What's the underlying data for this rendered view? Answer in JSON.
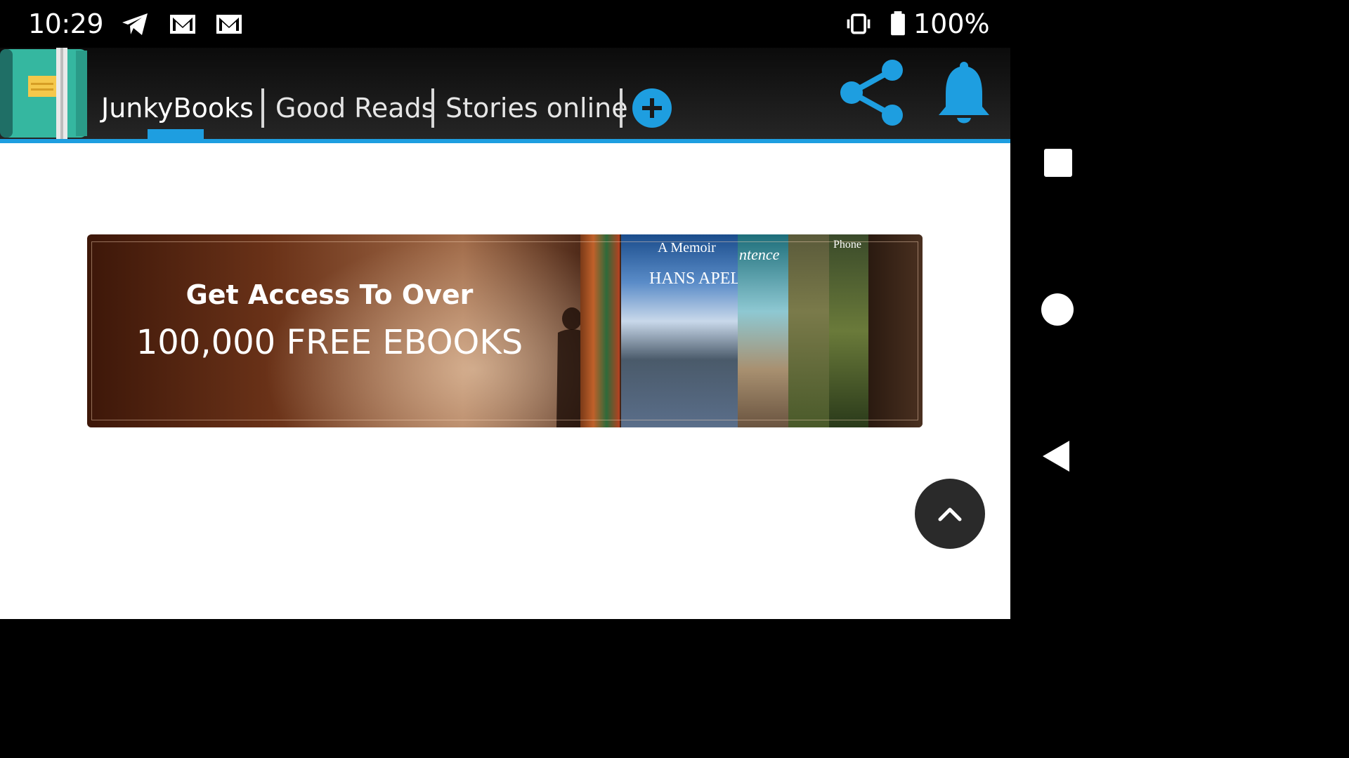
{
  "status_bar": {
    "time": "10:29",
    "notification_icons": [
      "telegram-icon",
      "gmail-icon",
      "gmail-icon"
    ],
    "system_icons": [
      "vibrate-icon",
      "battery-icon"
    ],
    "battery": "100%"
  },
  "app_bar": {
    "tabs": [
      {
        "label": "JunkyBooks",
        "active": true
      },
      {
        "label": "Good Reads",
        "active": false
      },
      {
        "label": "Stories online",
        "active": false
      }
    ],
    "accent_color": "#1e9ee0"
  },
  "banner": {
    "line1": "Get Access To Over",
    "line2": "100,000 FREE EBOOKS",
    "book_covers": [
      {
        "title": "A Memoir",
        "author": "HANS APEL"
      },
      {
        "title": "ntence"
      },
      {
        "title": "Phone"
      }
    ]
  },
  "fab": {
    "icon": "chevron-up-icon"
  },
  "nav_bar": {
    "buttons": [
      "recents-button",
      "home-button",
      "back-button"
    ]
  }
}
